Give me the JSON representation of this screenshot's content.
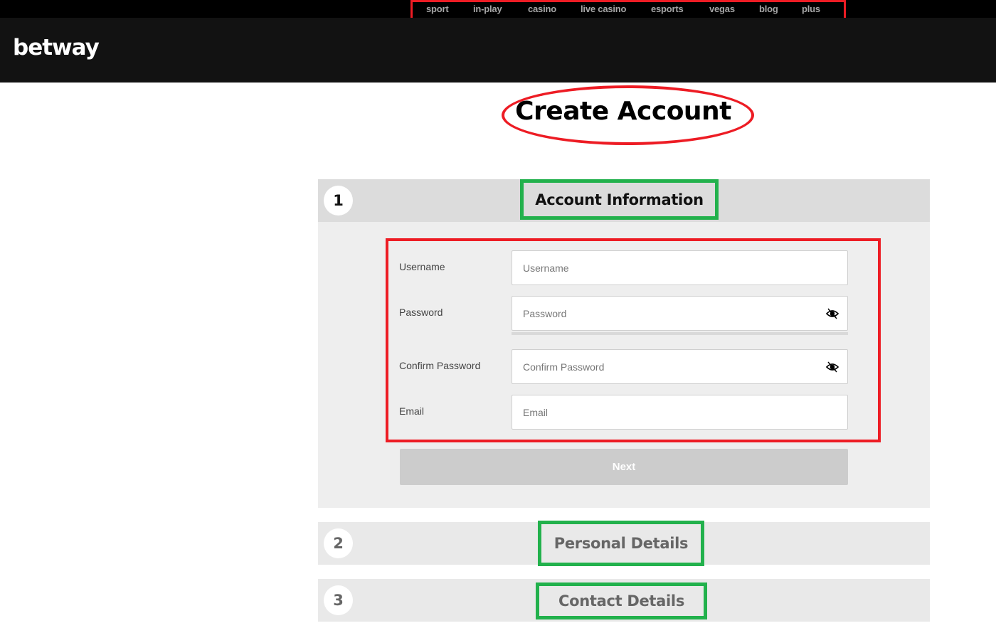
{
  "top_nav": {
    "items": [
      {
        "label": "sport"
      },
      {
        "label": "in-play"
      },
      {
        "label": "casino"
      },
      {
        "label": "live casino"
      },
      {
        "label": "esports"
      },
      {
        "label": "vegas"
      },
      {
        "label": "blog"
      },
      {
        "label": "plus"
      }
    ]
  },
  "header": {
    "logo": "betway"
  },
  "page": {
    "title": "Create Account"
  },
  "steps": [
    {
      "number": "1",
      "title": "Account Information",
      "state": "active"
    },
    {
      "number": "2",
      "title": "Personal Details",
      "state": "collapsed"
    },
    {
      "number": "3",
      "title": "Contact Details",
      "state": "collapsed"
    }
  ],
  "form": {
    "fields": [
      {
        "label": "Username",
        "placeholder": "Username",
        "value": ""
      },
      {
        "label": "Password",
        "placeholder": "Password",
        "value": "",
        "icon": "eye-slash-icon"
      },
      {
        "label": "Confirm Password",
        "placeholder": "Confirm Password",
        "value": "",
        "icon": "eye-slash-icon"
      },
      {
        "label": "Email",
        "placeholder": "Email",
        "value": ""
      }
    ],
    "next_label": "Next"
  },
  "annotation_colors": {
    "red": "#ed1c24",
    "green": "#22b14c"
  }
}
